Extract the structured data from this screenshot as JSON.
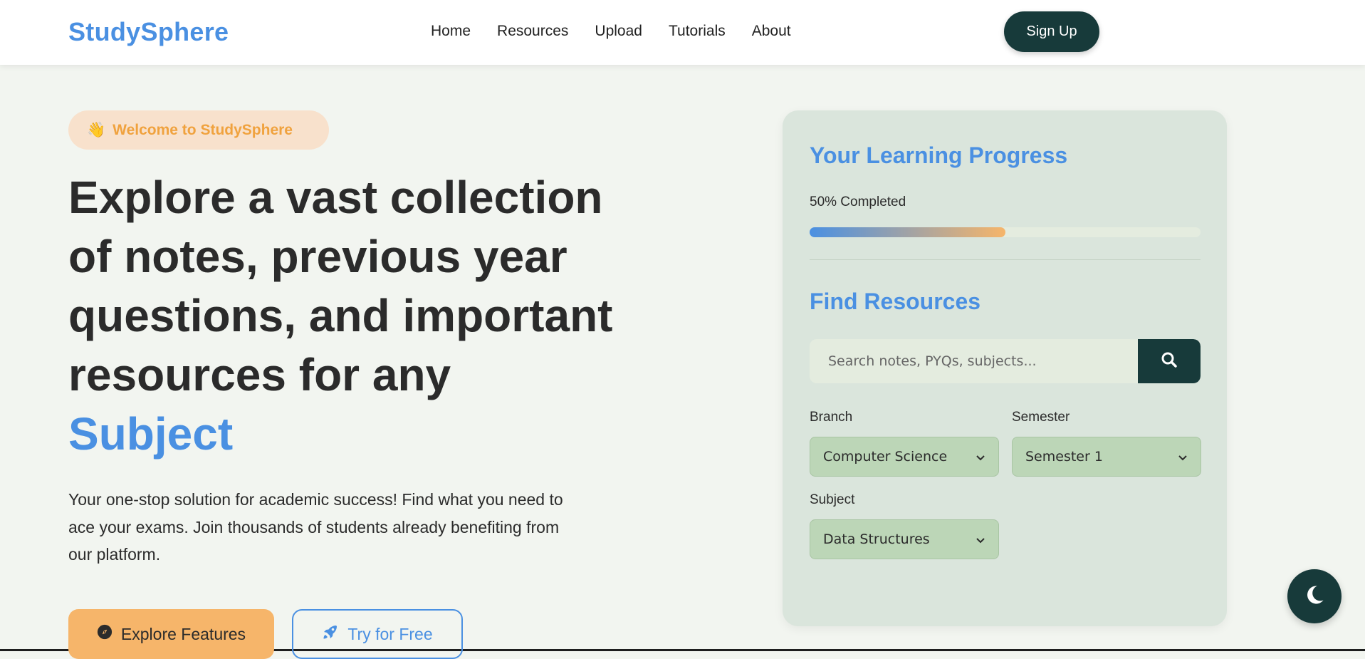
{
  "brand": {
    "name": "StudySphere"
  },
  "nav": {
    "links": [
      "Home",
      "Resources",
      "Upload",
      "Tutorials",
      "About"
    ],
    "signup_label": "Sign Up"
  },
  "hero": {
    "badge_text": "Welcome to StudySphere",
    "badge_emoji": "👋",
    "title_lines": [
      "Explore a vast collection",
      "of notes, previous year",
      "questions, and important",
      "resources for any"
    ],
    "title_accent": "Subject",
    "subtitle_lines": [
      "Your one-stop solution for academic success! Find what you need to",
      "ace your exams. Join thousands of students already benefiting from",
      "our platform."
    ],
    "explore_label": "Explore Features",
    "try_label": "Try for Free"
  },
  "progress": {
    "title": "Your Learning Progress",
    "label": "50% Completed",
    "percent": 50
  },
  "find": {
    "title": "Find Resources",
    "search_placeholder": "Search notes, PYQs, subjects...",
    "branch_label": "Branch",
    "branch_value": "Computer Science",
    "semester_label": "Semester",
    "semester_value": "Semester 1",
    "subject_label": "Subject",
    "subject_value": "Data Structures"
  },
  "icons": {
    "explore": "compass-icon",
    "try": "rocket-icon",
    "search": "search-icon",
    "theme": "moon-icon",
    "dropdown": "chevron-down-icon"
  },
  "colors": {
    "brand_blue": "#4a90e2",
    "dark_teal": "#173a3a",
    "accent_orange": "#f6b56a",
    "badge_text": "#f0a23e"
  }
}
